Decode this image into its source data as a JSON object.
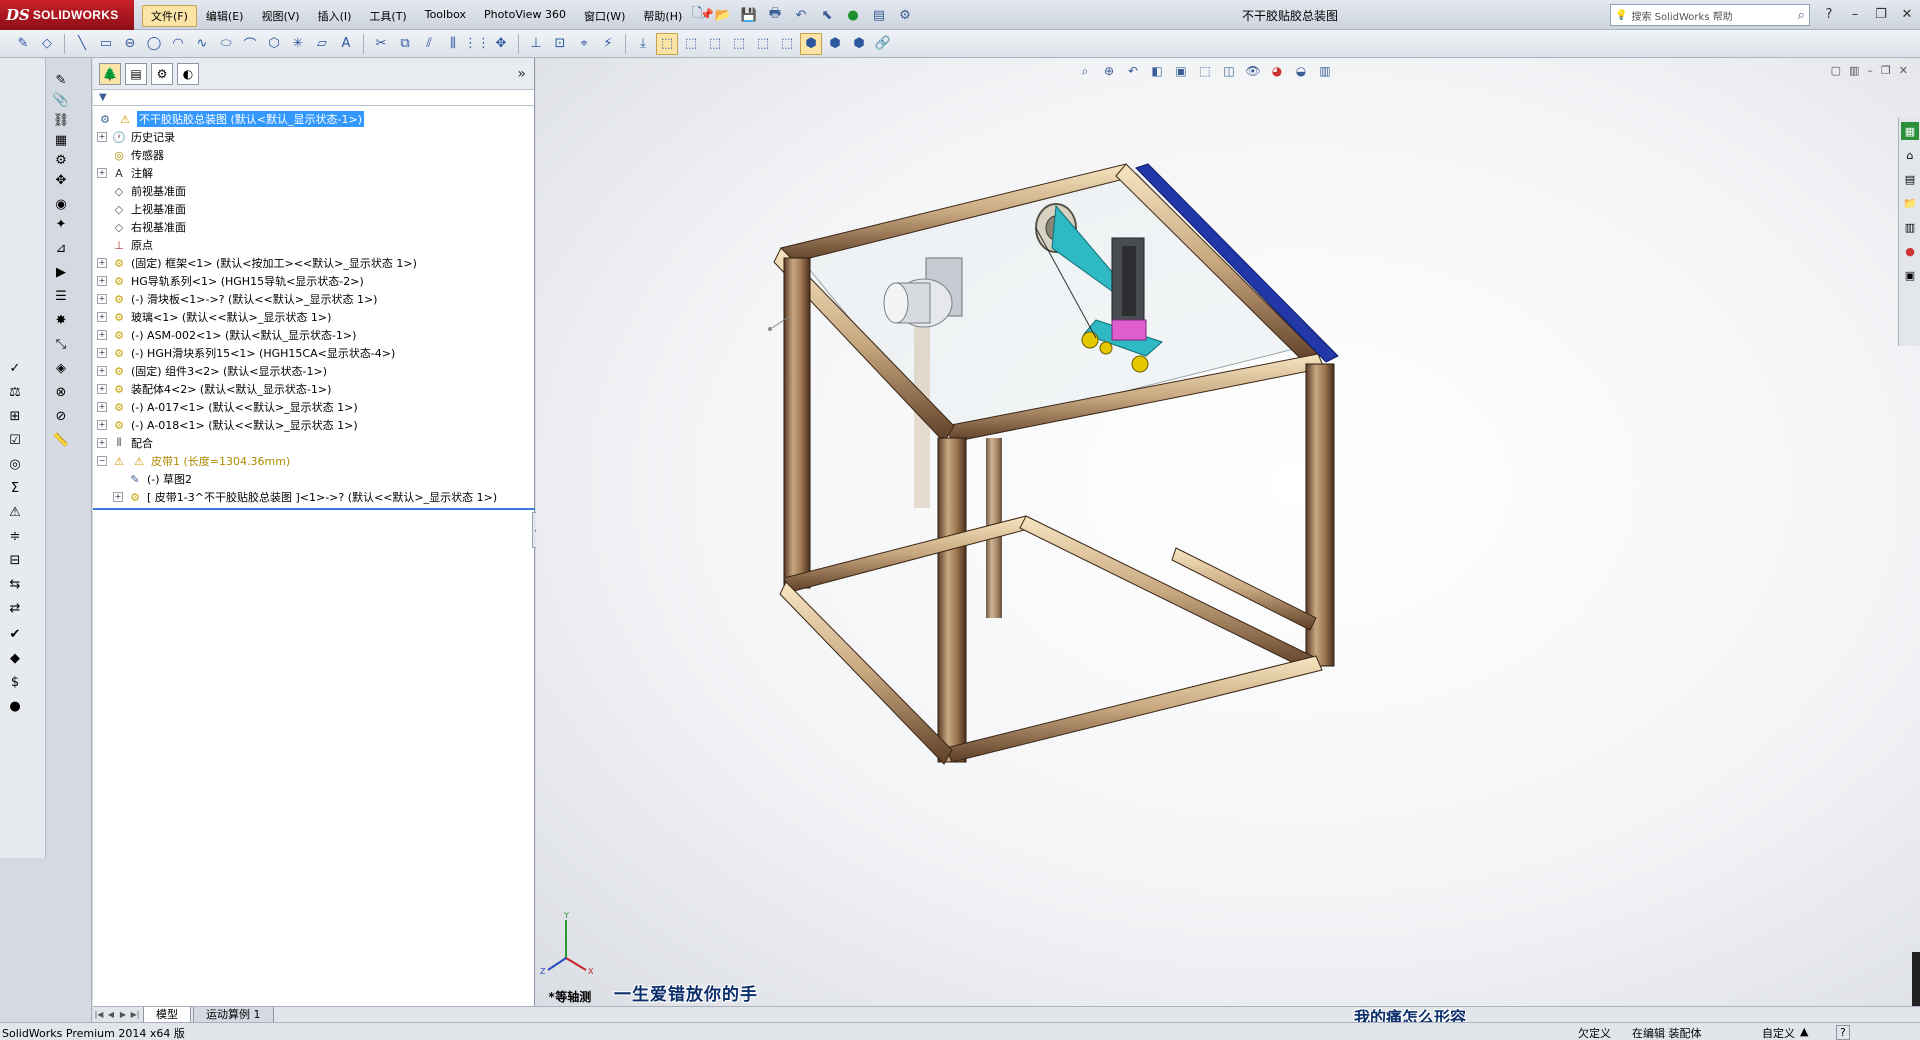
{
  "app": {
    "logo_ds": "DS",
    "logo_name": "SOLIDWORKS",
    "doc_title": "不干胶贴胶总装图"
  },
  "menu": [
    "文件(F)",
    "编辑(E)",
    "视图(V)",
    "插入(I)",
    "工具(T)",
    "Toolbox",
    "PhotoView 360",
    "窗口(W)",
    "帮助(H)"
  ],
  "search": {
    "placeholder": "搜索 SolidWorks 帮助"
  },
  "feature_tree": {
    "root": "不干胶贴胶总装图 (默认<默认_显示状态-1>)",
    "items": [
      {
        "label": "历史记录",
        "icon": "history-icon",
        "expandable": true
      },
      {
        "label": "传感器",
        "icon": "sensor-icon",
        "expandable": false
      },
      {
        "label": "注解",
        "icon": "annotation-icon",
        "expandable": true
      },
      {
        "label": "前视基准面",
        "icon": "plane-icon",
        "expandable": false
      },
      {
        "label": "上视基准面",
        "icon": "plane-icon",
        "expandable": false
      },
      {
        "label": "右视基准面",
        "icon": "plane-icon",
        "expandable": false
      },
      {
        "label": "原点",
        "icon": "origin-icon",
        "expandable": false
      },
      {
        "label": "(固定) 框架<1> (默认<按加工><<默认>_显示状态 1>)",
        "icon": "subassembly-icon",
        "expandable": true
      },
      {
        "label": "HG导轨系列<1> (HGH15导轨<显示状态-2>)",
        "icon": "part-icon",
        "expandable": true
      },
      {
        "label": "(-) 滑块板<1>->? (默认<<默认>_显示状态 1>)",
        "icon": "part-icon",
        "expandable": true
      },
      {
        "label": "玻璃<1> (默认<<默认>_显示状态 1>)",
        "icon": "part-icon",
        "expandable": true
      },
      {
        "label": "(-) ASM-002<1> (默认<默认_显示状态-1>)",
        "icon": "subassembly-icon",
        "expandable": true
      },
      {
        "label": "(-) HGH滑块系列15<1> (HGH15CA<显示状态-4>)",
        "icon": "part-icon",
        "expandable": true
      },
      {
        "label": "(固定) 组件3<2> (默认<显示状态-1>)",
        "icon": "subassembly-icon",
        "expandable": true
      },
      {
        "label": "装配体4<2> (默认<默认_显示状态-1>)",
        "icon": "subassembly-icon",
        "expandable": true
      },
      {
        "label": "(-) A-017<1> (默认<<默认>_显示状态 1>)",
        "icon": "part-icon",
        "expandable": true
      },
      {
        "label": "(-) A-018<1> (默认<<默认>_显示状态 1>)",
        "icon": "part-icon",
        "expandable": true
      },
      {
        "label": "配合",
        "icon": "mates-icon",
        "expandable": true
      },
      {
        "label": "皮带1 (长度=1304.36mm)",
        "icon": "belt-icon",
        "expandable": true,
        "expanded": true,
        "warning": true
      },
      {
        "label": "(-) 草图2",
        "icon": "sketch-icon",
        "expandable": false,
        "indent": 1
      },
      {
        "label": "[ 皮带1-3^不干胶贴胶总装图 ]<1>->? (默认<<默认>_显示状态 1>)",
        "icon": "part-icon",
        "expandable": true,
        "indent": 1
      }
    ]
  },
  "bottom_tabs": [
    "模型",
    "运动算例 1"
  ],
  "viewport": {
    "view_name": "*等轴测",
    "overlay_text_left": "一生爱错放你的手",
    "overlay_text_right": "我的痛怎么形容"
  },
  "status": {
    "app_version": "SolidWorks Premium 2014 x64 版",
    "definition": "欠定义",
    "editing": "在编辑 装配体",
    "units": "自定义",
    "help": "?"
  }
}
